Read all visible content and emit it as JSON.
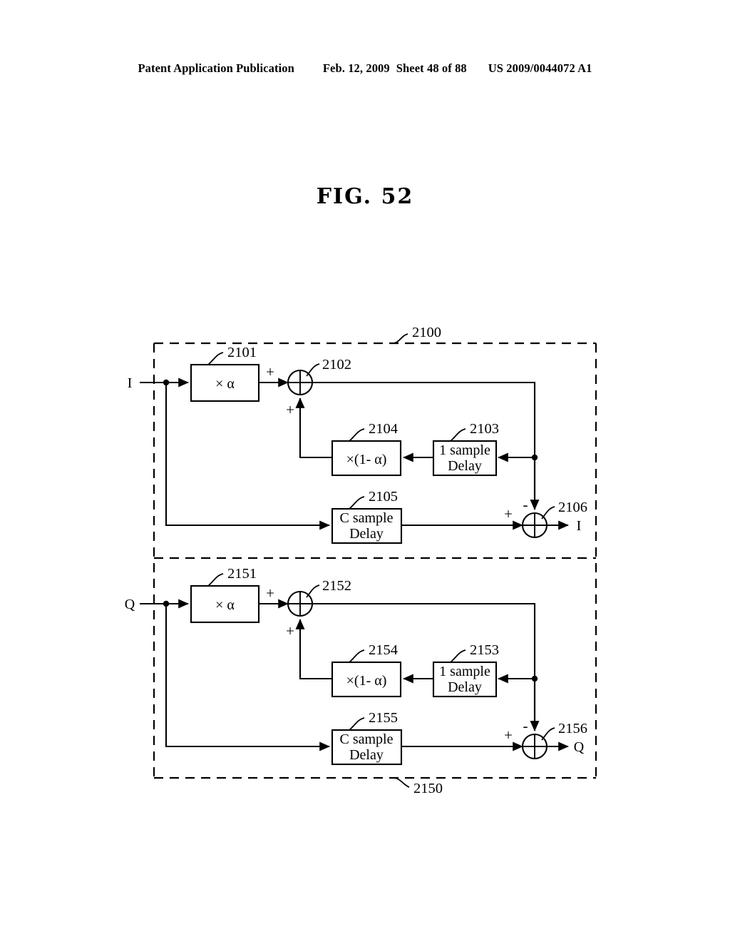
{
  "header": {
    "publication": "Patent Application Publication",
    "date": "Feb. 12, 2009",
    "sheet": "Sheet 48 of 88",
    "patent_number": "US 2009/0044072 A1"
  },
  "figure": {
    "title": "FIG. 52"
  },
  "diagram": {
    "type": "block-diagram",
    "outer_group_label": "2100",
    "lower_group_label": "2150",
    "inputs": [
      {
        "name": "input-i",
        "label": "I"
      },
      {
        "name": "input-q",
        "label": "Q"
      }
    ],
    "outputs": [
      {
        "name": "output-i",
        "label": "I"
      },
      {
        "name": "output-q",
        "label": "Q"
      }
    ],
    "signs": {
      "plus": "+",
      "minus": "-"
    },
    "blocks": [
      {
        "id": "2101",
        "ref": "2101",
        "text": "× α",
        "lines": [
          "× α"
        ],
        "branch": "I"
      },
      {
        "id": "2103",
        "ref": "2103",
        "text": "1 sample Delay",
        "lines": [
          "1 sample",
          "Delay"
        ],
        "branch": "I"
      },
      {
        "id": "2104",
        "ref": "2104",
        "text": "×(1- α)",
        "lines": [
          "×(1- α)"
        ],
        "branch": "I"
      },
      {
        "id": "2105",
        "ref": "2105",
        "text": "C sample Delay",
        "lines": [
          "C sample",
          "Delay"
        ],
        "branch": "I"
      },
      {
        "id": "2151",
        "ref": "2151",
        "text": "× α",
        "lines": [
          "× α"
        ],
        "branch": "Q"
      },
      {
        "id": "2153",
        "ref": "2153",
        "text": "1 sample Delay",
        "lines": [
          "1 sample",
          "Delay"
        ],
        "branch": "Q"
      },
      {
        "id": "2154",
        "ref": "2154",
        "text": "×(1- α)",
        "lines": [
          "×(1- α)"
        ],
        "branch": "Q"
      },
      {
        "id": "2155",
        "ref": "2155",
        "text": "C sample Delay",
        "lines": [
          "C sample",
          "Delay"
        ],
        "branch": "Q"
      }
    ],
    "adders": [
      {
        "id": "2102",
        "ref": "2102",
        "branch": "I",
        "inputs": [
          "+",
          "+"
        ]
      },
      {
        "id": "2106",
        "ref": "2106",
        "branch": "I",
        "inputs": [
          "+",
          "-"
        ]
      },
      {
        "id": "2152",
        "ref": "2152",
        "branch": "Q",
        "inputs": [
          "+",
          "+"
        ]
      },
      {
        "id": "2156",
        "ref": "2156",
        "branch": "Q",
        "inputs": [
          "+",
          "-"
        ]
      }
    ]
  }
}
